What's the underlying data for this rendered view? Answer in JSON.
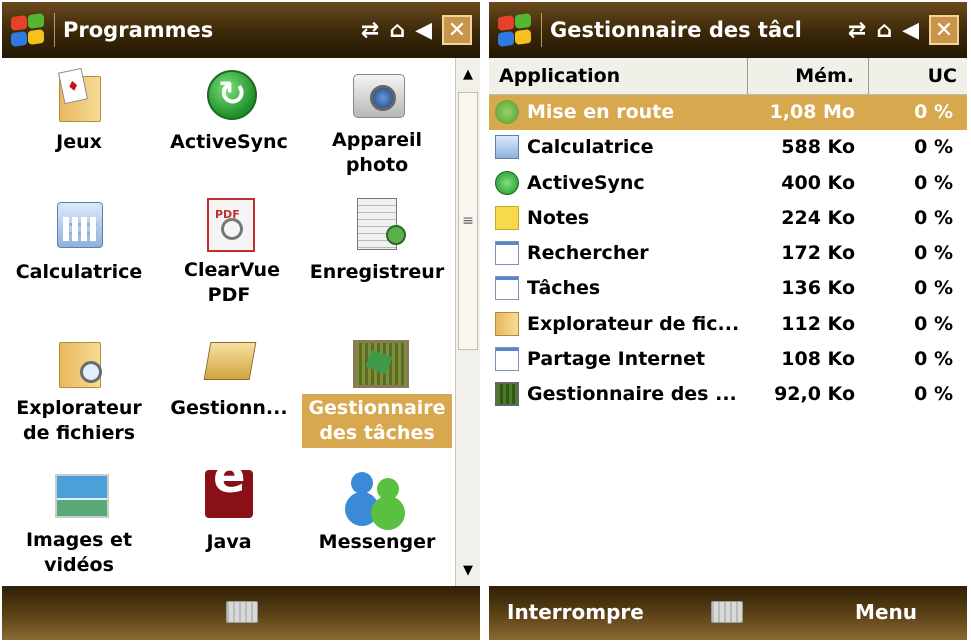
{
  "left": {
    "title": "Programmes",
    "programs": [
      {
        "label": "Jeux",
        "icon": "games-icon"
      },
      {
        "label": "ActiveSync",
        "icon": "activesync-icon"
      },
      {
        "label": "Appareil photo",
        "icon": "camera-icon"
      },
      {
        "label": "Calculatrice",
        "icon": "calculator-icon"
      },
      {
        "label": "ClearVue PDF",
        "icon": "pdf-icon"
      },
      {
        "label": "Enregistreur",
        "icon": "recorder-icon"
      },
      {
        "label": "Explorateur de fichiers",
        "icon": "file-explorer-icon"
      },
      {
        "label": "Gestionn...",
        "icon": "card-manager-icon"
      },
      {
        "label": "Gestionnaire des tâches",
        "icon": "task-manager-icon"
      },
      {
        "label": "Images et vidéos",
        "icon": "pictures-icon"
      },
      {
        "label": "Java",
        "icon": "java-icon"
      },
      {
        "label": "Messenger",
        "icon": "messenger-icon"
      }
    ],
    "selected_index": 8
  },
  "right": {
    "title": "Gestionnaire des tâcl",
    "columns": {
      "app": "Application",
      "mem": "Mém.",
      "uc": "UC"
    },
    "rows": [
      {
        "name": "Mise en route",
        "mem": "1,08 Mo",
        "uc": "0 %",
        "icon": "getting-started-icon",
        "selected": true
      },
      {
        "name": "Calculatrice",
        "mem": "588 Ko",
        "uc": "0 %",
        "icon": "calculator-icon"
      },
      {
        "name": "ActiveSync",
        "mem": "400 Ko",
        "uc": "0 %",
        "icon": "activesync-icon"
      },
      {
        "name": "Notes",
        "mem": "224 Ko",
        "uc": "0 %",
        "icon": "notes-icon"
      },
      {
        "name": "Rechercher",
        "mem": "172 Ko",
        "uc": "0 %",
        "icon": "window-icon"
      },
      {
        "name": "Tâches",
        "mem": "136 Ko",
        "uc": "0 %",
        "icon": "window-icon"
      },
      {
        "name": "Explorateur de fic...",
        "mem": "112 Ko",
        "uc": "0 %",
        "icon": "file-explorer-icon"
      },
      {
        "name": "Partage Internet",
        "mem": "108 Ko",
        "uc": "0 %",
        "icon": "window-icon"
      },
      {
        "name": "Gestionnaire des ...",
        "mem": "92,0 Ko",
        "uc": "0 %",
        "icon": "task-manager-icon"
      }
    ],
    "softkey_left": "Interrompre",
    "softkey_right": "Menu"
  },
  "status_icons": [
    "connectivity-icon",
    "battery-icon",
    "volume-icon"
  ],
  "colors": {
    "titlebar": "#3a2808",
    "selection": "#d8a84e",
    "close_button": "#c8964a"
  }
}
